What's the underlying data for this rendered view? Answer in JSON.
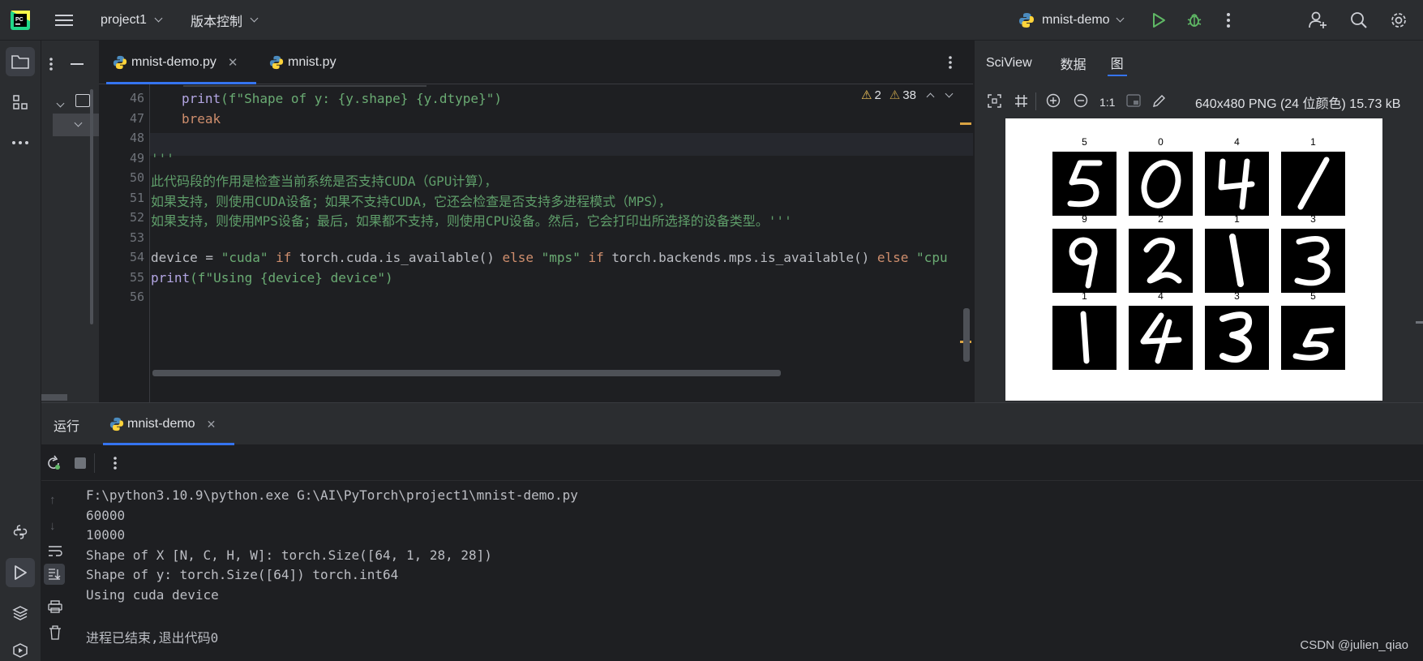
{
  "titlebar": {
    "project": "project1",
    "vcs": "版本控制",
    "run_config": "mnist-demo"
  },
  "editor": {
    "tabs": [
      {
        "label": "mnist-demo.py",
        "active": true
      },
      {
        "label": "mnist.py",
        "active": false
      }
    ],
    "inspections": {
      "warnings": "2",
      "weak_warnings": "38"
    },
    "line_numbers": [
      "46",
      "47",
      "48",
      "49",
      "50",
      "51",
      "52",
      "53",
      "54",
      "55",
      "56"
    ],
    "code": {
      "l46_print": "print",
      "l46_rest": "(f\"Shape of y: {y.shape} {y.dtype}\")",
      "l47_break": "break",
      "l49": "'''",
      "l50": "此代码段的作用是检查当前系统是否支持CUDA（GPU计算），",
      "l51": "如果支持，则使用CUDA设备；如果不支持CUDA，它还会检查是否支持多进程模式（MPS），",
      "l52": "如果支持，则使用MPS设备；最后，如果都不支持，则使用CPU设备。然后，它会打印出所选择的设备类型。'''",
      "l54_a": "device = ",
      "l54_b": "\"cuda\"",
      "l54_c": " if ",
      "l54_d": "torch.cuda.is_available() ",
      "l54_e": "else ",
      "l54_f": "\"mps\"",
      "l54_g": " if ",
      "l54_h": "torch.backends.mps.is_available() ",
      "l54_i": "else ",
      "l54_j": "\"cpu",
      "l55_print": "print",
      "l55_rest": "(f\"Using {device} device\")"
    }
  },
  "sciview": {
    "tabs": [
      "SciView",
      "数据",
      "图"
    ],
    "zoom_label": "1:1",
    "image_info": "640x480 PNG (24 位颜色) 15.73 kB",
    "digit_labels": [
      [
        "5",
        "0",
        "4",
        "1"
      ],
      [
        "9",
        "2",
        "1",
        "3"
      ],
      [
        "1",
        "4",
        "3",
        "5"
      ]
    ]
  },
  "run": {
    "tab_title": "运行",
    "tab_config": "mnist-demo",
    "output": [
      "F:\\python3.10.9\\python.exe G:\\AI\\PyTorch\\project1\\mnist-demo.py",
      "60000",
      "10000",
      "Shape of X [N, C, H, W]: torch.Size([64, 1, 28, 28])",
      "Shape of y: torch.Size([64]) torch.int64",
      "Using cuda device",
      "",
      "进程已结束,退出代码0"
    ]
  },
  "watermark": "CSDN @julien_qiao",
  "colors": {
    "accent_green": "#5fb865",
    "warning_yellow": "#f2c55c",
    "background": "#1e1f22",
    "panel": "#2b2d30"
  }
}
